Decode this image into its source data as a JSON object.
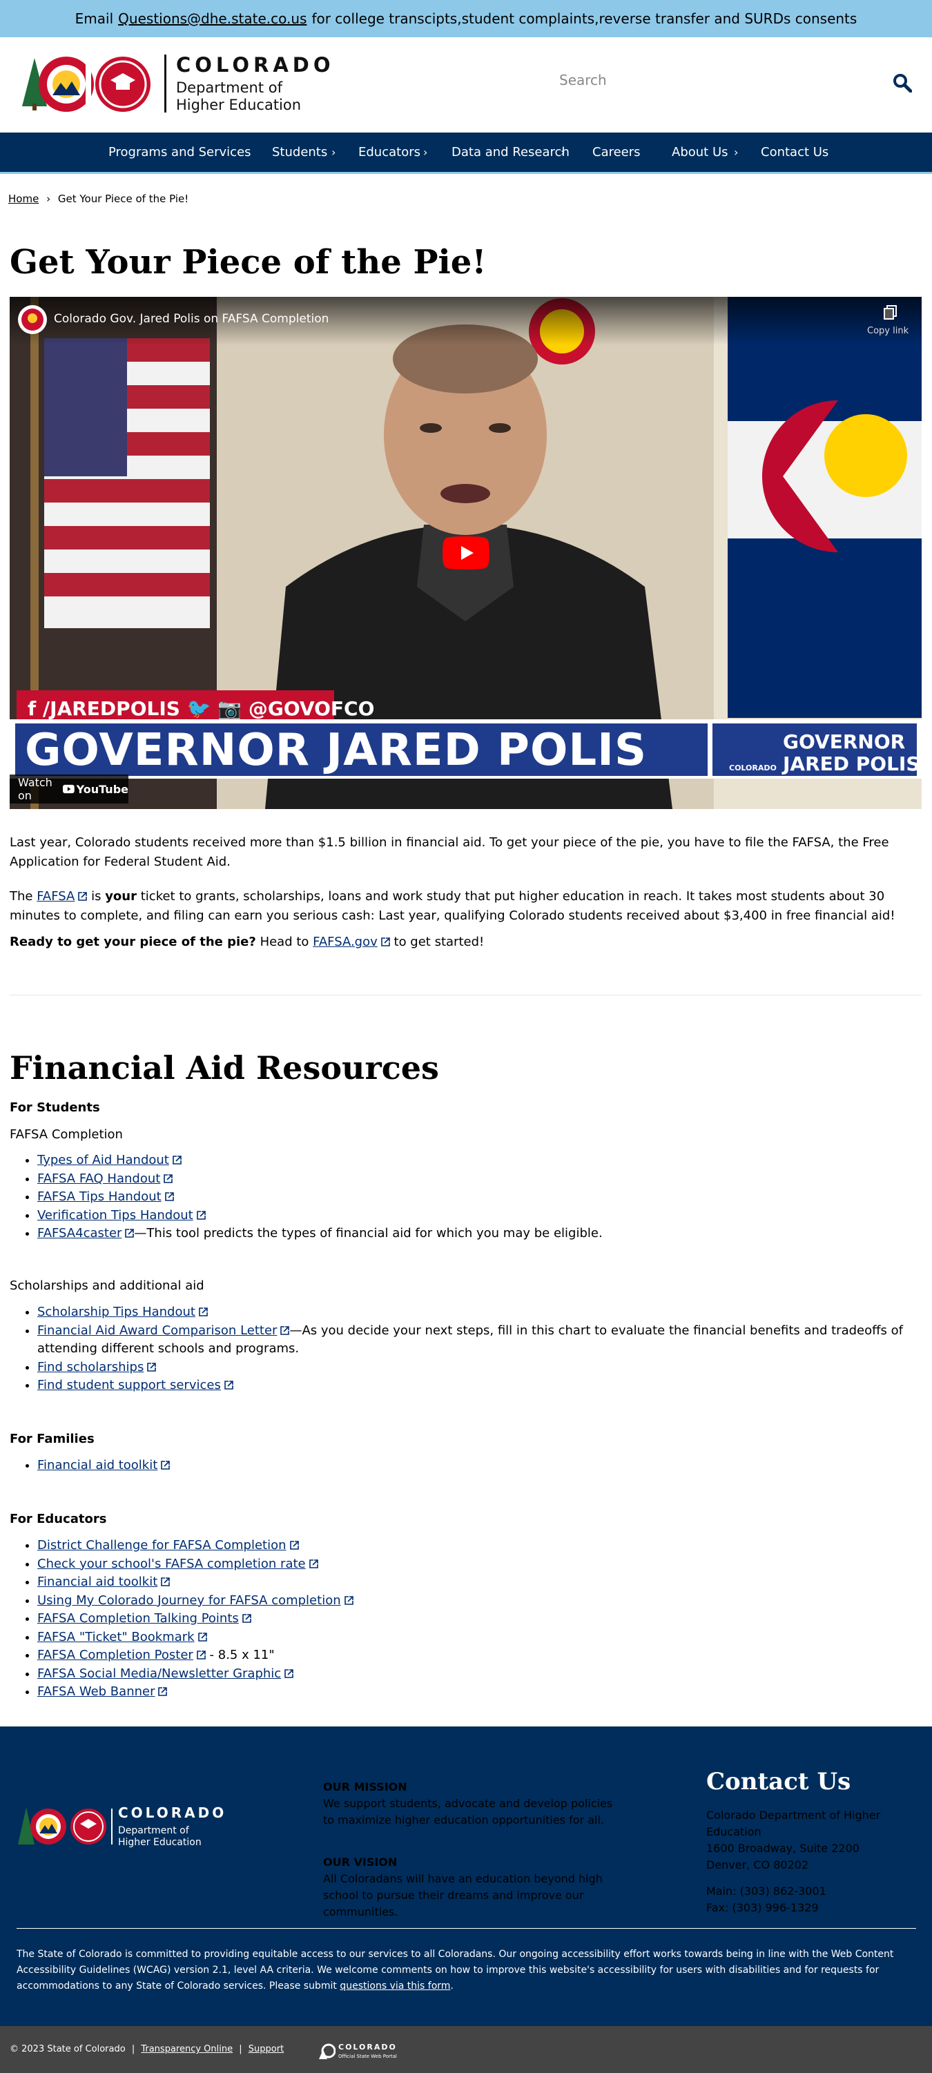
{
  "topbar": {
    "prefix": "Email",
    "email": "Questions@dhe.state.co.us",
    "suffix": "for college transcipts,student complaints,reverse transfer and SURDs consents"
  },
  "logo": {
    "state": "COLORADO",
    "dept_line1": "Department of",
    "dept_line2": "Higher Education",
    "badge": "CDHE"
  },
  "search": {
    "placeholder": "Search"
  },
  "nav": {
    "items": [
      "Programs and Services",
      "Students",
      "Educators",
      "Data and Research",
      "Careers",
      "About Us",
      "Contact Us"
    ]
  },
  "breadcrumb": {
    "home": "Home",
    "separator": "›",
    "current": "Get Your Piece of the Pie!"
  },
  "page_title": "Get Your Piece of the Pie!",
  "video": {
    "title": "Colorado Gov. Jared Polis on FAFSA Completion",
    "copy_link": "Copy link",
    "social": "f /JAREDPOLIS   🐦 📷 @GOVOFCO",
    "lower_third": "GOVERNOR JARED POLIS",
    "lower_third_right_line1": "GOVERNOR",
    "lower_third_right_line2": "JARED POLIS",
    "lower_third_right_logo": "COLORADO",
    "watch_on": "Watch on",
    "youtube": "YouTube"
  },
  "intro": {
    "p1": "Last year, Colorado students received more than $1.5 billion in financial aid. To get your piece of the pie, you have to file the FAFSA, the Free Application for Federal Student Aid.",
    "p2_a": "The",
    "p2_link": "FAFSA",
    "p2_b": "is",
    "p2_bold": "your",
    "p2_c": "ticket to grants, scholarships, loans and work study that put higher education in reach. It takes most students about 30 minutes to complete, and filing can earn you serious cash: Last year, qualifying Colorado students received about $3,400 in free financial aid!",
    "p3_bold": "Ready to get your piece of the pie?",
    "p3_a": "Head to",
    "p3_link": "FAFSA.gov",
    "p3_b": "to get started!"
  },
  "resources": {
    "title": "Financial Aid Resources",
    "for_students": "For Students",
    "fafsa_completion": "FAFSA Completion",
    "fafsa_links": [
      {
        "label": "Types of Aid Handout",
        "after": ""
      },
      {
        "label": "FAFSA FAQ Handout",
        "after": ""
      },
      {
        "label": "FAFSA Tips Handout",
        "after": ""
      },
      {
        "label": "Verification Tips Handout",
        "after": ""
      },
      {
        "label": "FAFSA4caster",
        "after": "—This tool predicts the types of financial aid for which you may be eligible."
      }
    ],
    "scholarships": "Scholarships and additional aid",
    "scholarship_links": [
      {
        "label": "Scholarship Tips Handout",
        "after": ""
      },
      {
        "label": "Financial Aid Award Comparison Letter",
        "after": "—As you decide your next steps, fill in this chart to evaluate the financial benefits and tradeoffs of attending different schools and programs."
      },
      {
        "label": "Find scholarships",
        "after": ""
      },
      {
        "label": "Find student support services",
        "after": ""
      }
    ],
    "for_families": "For Families",
    "family_links": [
      {
        "label": "Financial aid toolkit",
        "after": ""
      }
    ],
    "for_educators": "For Educators",
    "educator_links": [
      {
        "label": "District Challenge for FAFSA Completion",
        "after": ""
      },
      {
        "label": "Check your school's FAFSA completion rate",
        "after": ""
      },
      {
        "label": "Financial aid toolkit",
        "after": ""
      },
      {
        "label": "Using My Colorado Journey for FAFSA completion",
        "after": ""
      },
      {
        "label": "FAFSA Completion Talking Points",
        "after": ""
      },
      {
        "label": "FAFSA \"Ticket\" Bookmark",
        "after": ""
      },
      {
        "label": "FAFSA Completion Poster",
        "after": " - 8.5 x 11\""
      },
      {
        "label": "FAFSA Social Media/Newsletter Graphic",
        "after": ""
      },
      {
        "label": "FAFSA Web Banner",
        "after": ""
      }
    ]
  },
  "footer": {
    "mission_title": "OUR MISSION",
    "mission_text": "We support students, advocate and develop policies to maximize higher education opportunities for all.",
    "vision_title": "OUR VISION",
    "vision_text": "All Coloradans will have an education beyond high school to pursue their dreams and improve our communities.",
    "contact_title": "Contact Us",
    "org": "Colorado Department of Higher Education",
    "address1": "1600 Broadway, Suite 2200",
    "address2": "Denver, CO 80202",
    "main": "Main: (303) 862-3001",
    "fax": "Fax: (303) 996-1329",
    "access_text": "The State of Colorado is committed to providing equitable access to our services to all Coloradans. Our ongoing accessibility effort works towards being in line with the Web Content Accessibility Guidelines (WCAG) version 2.1, level AA criteria. We welcome comments on how to improve this website's accessibility for users with disabilities and for requests for accommodations to any State of Colorado services. Please submit",
    "access_link": "questions via this form",
    "access_end": ".",
    "copyright": "© 2023 State of Colorado",
    "transparency": "Transparency Online",
    "support": "Support",
    "portal_name": "COLORADO",
    "portal_sub": "Official State Web Portal"
  },
  "colors": {
    "topbar": "#8dc8e8",
    "navy": "#002d5b",
    "link": "#002d72",
    "bottombar": "#444444"
  }
}
